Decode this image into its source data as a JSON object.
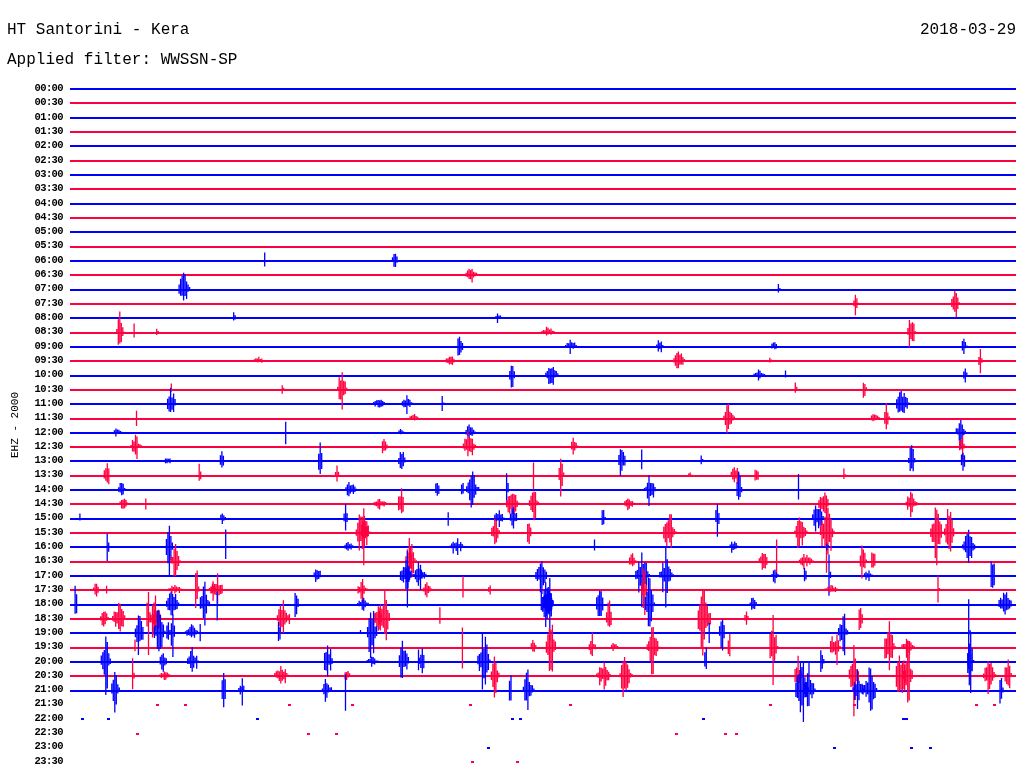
{
  "header": {
    "station": "HT Santorini - Kera",
    "date": "2018-03-29",
    "filter": "Applied filter: WWSSN-SP"
  },
  "y_axis_label": "EHZ - 2000",
  "rows": [
    {
      "label": "00:00",
      "color": "#0000ff",
      "trace": true
    },
    {
      "label": "00:30",
      "color": "#ff0040",
      "trace": true
    },
    {
      "label": "01:00",
      "color": "#0000ff",
      "trace": true
    },
    {
      "label": "01:30",
      "color": "#ff0040",
      "trace": true
    },
    {
      "label": "02:00",
      "color": "#0000ff",
      "trace": true
    },
    {
      "label": "02:30",
      "color": "#ff0040",
      "trace": true
    },
    {
      "label": "03:00",
      "color": "#0000ff",
      "trace": true
    },
    {
      "label": "03:30",
      "color": "#ff0040",
      "trace": true
    },
    {
      "label": "04:00",
      "color": "#0000ff",
      "trace": true
    },
    {
      "label": "04:30",
      "color": "#ff0040",
      "trace": true
    },
    {
      "label": "05:00",
      "color": "#0000ff",
      "trace": true
    },
    {
      "label": "05:30",
      "color": "#ff0040",
      "trace": true
    },
    {
      "label": "06:00",
      "color": "#0000ff",
      "trace": true
    },
    {
      "label": "06:30",
      "color": "#ff0040",
      "trace": true
    },
    {
      "label": "07:00",
      "color": "#0000ff",
      "trace": true
    },
    {
      "label": "07:30",
      "color": "#ff0040",
      "trace": true
    },
    {
      "label": "08:00",
      "color": "#0000ff",
      "trace": true
    },
    {
      "label": "08:30",
      "color": "#ff0040",
      "trace": true
    },
    {
      "label": "09:00",
      "color": "#0000ff",
      "trace": true
    },
    {
      "label": "09:30",
      "color": "#ff0040",
      "trace": true
    },
    {
      "label": "10:00",
      "color": "#0000ff",
      "trace": true
    },
    {
      "label": "10:30",
      "color": "#ff0040",
      "trace": true
    },
    {
      "label": "11:00",
      "color": "#0000ff",
      "trace": true
    },
    {
      "label": "11:30",
      "color": "#ff0040",
      "trace": true
    },
    {
      "label": "12:00",
      "color": "#0000ff",
      "trace": true
    },
    {
      "label": "12:30",
      "color": "#ff0040",
      "trace": true
    },
    {
      "label": "13:00",
      "color": "#0000ff",
      "trace": true
    },
    {
      "label": "13:30",
      "color": "#ff0040",
      "trace": true
    },
    {
      "label": "14:00",
      "color": "#0000ff",
      "trace": true
    },
    {
      "label": "14:30",
      "color": "#ff0040",
      "trace": true
    },
    {
      "label": "15:00",
      "color": "#0000ff",
      "trace": true
    },
    {
      "label": "15:30",
      "color": "#ff0040",
      "trace": true
    },
    {
      "label": "16:00",
      "color": "#0000ff",
      "trace": true
    },
    {
      "label": "16:30",
      "color": "#ff0040",
      "trace": true
    },
    {
      "label": "17:00",
      "color": "#0000ff",
      "trace": true
    },
    {
      "label": "17:30",
      "color": "#ff0040",
      "trace": true
    },
    {
      "label": "18:00",
      "color": "#0000ff",
      "trace": true
    },
    {
      "label": "18:30",
      "color": "#ff0040",
      "trace": true
    },
    {
      "label": "19:00",
      "color": "#0000ff",
      "trace": true
    },
    {
      "label": "19:30",
      "color": "#ff0040",
      "trace": true
    },
    {
      "label": "20:00",
      "color": "#0000ff",
      "trace": true
    },
    {
      "label": "20:30",
      "color": "#ff0040",
      "trace": true
    },
    {
      "label": "21:00",
      "color": "#0000ff",
      "trace": true
    },
    {
      "label": "21:30",
      "color": "#ff0040",
      "trace": false
    },
    {
      "label": "22:00",
      "color": "#0000ff",
      "trace": false
    },
    {
      "label": "22:30",
      "color": "#ff0040",
      "trace": false
    },
    {
      "label": "23:00",
      "color": "#0000ff",
      "trace": false
    },
    {
      "label": "23:30",
      "color": "#ff0040",
      "trace": false
    }
  ]
}
